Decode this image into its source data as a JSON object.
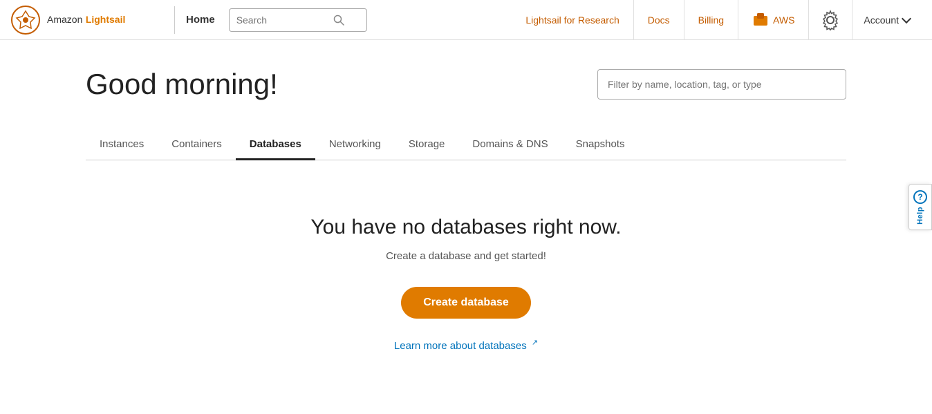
{
  "header": {
    "logo_amazon": "Amazon",
    "logo_lightsail": "Lightsail",
    "home_label": "Home",
    "search_placeholder": "Search",
    "nav": {
      "research": "Lightsail for Research",
      "docs": "Docs",
      "billing": "Billing",
      "aws": "AWS"
    },
    "account_label": "Account"
  },
  "main": {
    "greeting": "Good morning!",
    "filter_placeholder": "Filter by name, location, tag, or type",
    "tabs": [
      {
        "label": "Instances",
        "id": "instances",
        "active": false
      },
      {
        "label": "Containers",
        "id": "containers",
        "active": false
      },
      {
        "label": "Databases",
        "id": "databases",
        "active": true
      },
      {
        "label": "Networking",
        "id": "networking",
        "active": false
      },
      {
        "label": "Storage",
        "id": "storage",
        "active": false
      },
      {
        "label": "Domains & DNS",
        "id": "domains-dns",
        "active": false
      },
      {
        "label": "Snapshots",
        "id": "snapshots",
        "active": false
      }
    ],
    "empty_state": {
      "title": "You have no databases right now.",
      "subtitle": "Create a database and get started!",
      "create_button": "Create database",
      "learn_more": "Learn more about databases"
    }
  },
  "help": {
    "label": "Help"
  }
}
